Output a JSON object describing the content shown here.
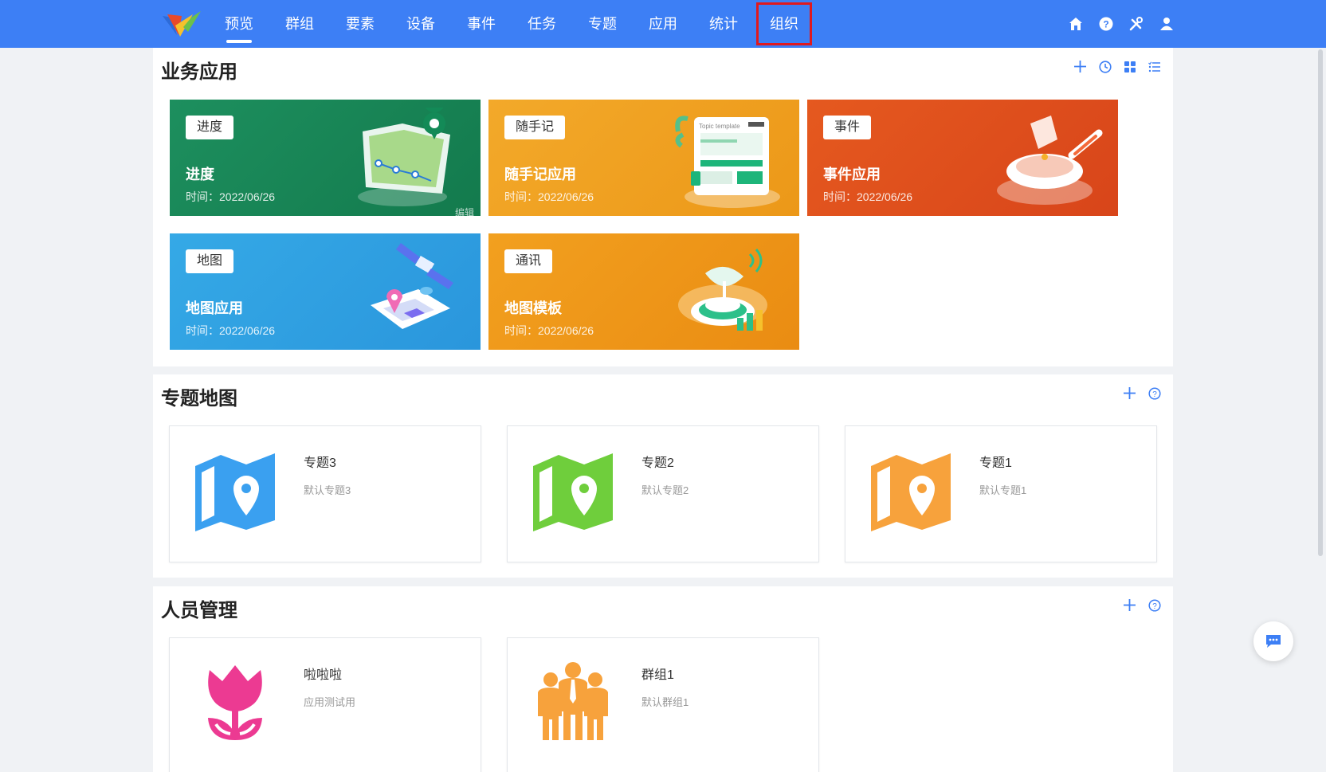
{
  "nav": {
    "items": [
      {
        "label": "预览",
        "active": true
      },
      {
        "label": "群组"
      },
      {
        "label": "要素"
      },
      {
        "label": "设备"
      },
      {
        "label": "事件"
      },
      {
        "label": "任务"
      },
      {
        "label": "专题"
      },
      {
        "label": "应用"
      },
      {
        "label": "统计"
      },
      {
        "label": "组织",
        "highlighted": true
      }
    ],
    "icons": [
      "home-icon",
      "help-icon",
      "tools-icon",
      "user-icon"
    ]
  },
  "business": {
    "title": "业务应用",
    "tools": [
      "plus-icon",
      "clock-icon",
      "grid-icon",
      "list-icon"
    ],
    "cards": [
      {
        "tag": "进度",
        "name": "进度",
        "time_label": "时间：",
        "time": "2022/06/26",
        "color": "#1e8c5a",
        "overlay_text": "编辑"
      },
      {
        "tag": "随手记",
        "name": "随手记应用",
        "time_label": "时间：",
        "time": "2022/06/26",
        "color": "#f2a623",
        "illus_text": "Topic template"
      },
      {
        "tag": "事件",
        "name": "事件应用",
        "time_label": "时间：",
        "time": "2022/06/26",
        "color": "#e2531f"
      },
      {
        "tag": "地图",
        "name": "地图应用",
        "time_label": "时间：",
        "time": "2022/06/26",
        "color": "#3aa9e4"
      },
      {
        "tag": "通讯",
        "name": "地图模板",
        "time_label": "时间：",
        "time": "2022/06/26",
        "color": "#f19a1b"
      }
    ]
  },
  "topics": {
    "title": "专题地图",
    "tools": [
      "plus-icon",
      "help-icon"
    ],
    "cards": [
      {
        "title": "专题3",
        "desc": "默认专题3",
        "color": "#3aa0f0"
      },
      {
        "title": "专题2",
        "desc": "默认专题2",
        "color": "#6fce3c"
      },
      {
        "title": "专题1",
        "desc": "默认专题1",
        "color": "#f7a23c"
      }
    ]
  },
  "people": {
    "title": "人员管理",
    "tools": [
      "plus-icon",
      "help-icon"
    ],
    "cards": [
      {
        "title": "啦啦啦",
        "desc": "应用测试用",
        "color": "#ec3a92",
        "icon": "tulip-icon"
      },
      {
        "title": "群组1",
        "desc": "默认群组1",
        "color": "#f7a23c",
        "icon": "group-icon"
      }
    ]
  },
  "chat": {
    "icon": "chat-icon"
  }
}
